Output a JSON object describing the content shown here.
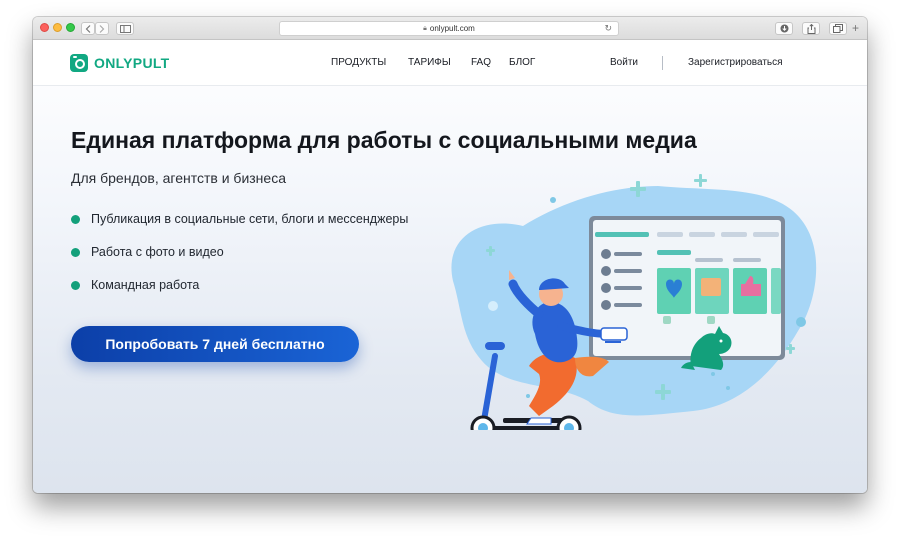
{
  "browser": {
    "url": "onlypult.com"
  },
  "header": {
    "logo_text": "ONLYPULT",
    "nav": [
      "ПРОДУКТЫ",
      "ТАРИФЫ",
      "FAQ",
      "БЛОГ"
    ],
    "login": "Войти",
    "register": "Зарегистрироваться"
  },
  "hero": {
    "title": "Единая платформа для работы с социальными медиа",
    "subtitle": "Для брендов, агентств и бизнеса",
    "features": [
      "Публикация в социальные сети, блоги и мессенджеры",
      "Работа с фото и видео",
      "Командная работа"
    ],
    "cta": "Попробовать 7 дней бесплатно"
  },
  "colors": {
    "brand": "#11a882",
    "cta": "#0c3fa8",
    "bullet": "#13a07b"
  }
}
